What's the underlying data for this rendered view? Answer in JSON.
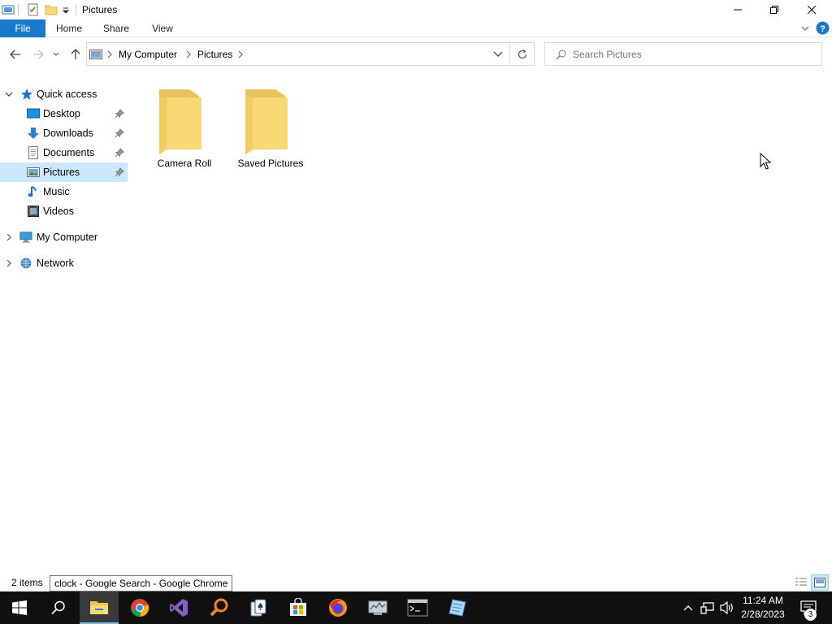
{
  "window": {
    "title": "Pictures",
    "minimize_icon": "minimize-icon",
    "restore_icon": "restore-icon",
    "close_icon": "close-icon"
  },
  "ribbon": {
    "tabs": [
      {
        "label": "File"
      },
      {
        "label": "Home"
      },
      {
        "label": "Share"
      },
      {
        "label": "View"
      }
    ],
    "accent": "#1979ca"
  },
  "address": {
    "crumbs": [
      "My Computer",
      "Pictures"
    ]
  },
  "search": {
    "placeholder": "Search Pictures"
  },
  "nav": {
    "quick_access": "Quick access",
    "items": [
      {
        "label": "Desktop",
        "pinned": true
      },
      {
        "label": "Downloads",
        "pinned": true
      },
      {
        "label": "Documents",
        "pinned": true
      },
      {
        "label": "Pictures",
        "pinned": true,
        "selected": true
      },
      {
        "label": "Music",
        "pinned": false
      },
      {
        "label": "Videos",
        "pinned": false
      }
    ],
    "my_computer": "My Computer",
    "network": "Network",
    "selected_color": "#cce8ff"
  },
  "content": {
    "folders": [
      {
        "name": "Camera Roll"
      },
      {
        "name": "Saved Pictures"
      }
    ]
  },
  "status": {
    "item_count": "2 items",
    "tooltip": "clock - Google Search - Google Chrome"
  },
  "taskbar": {
    "apps": [
      "start-icon",
      "search-icon",
      "file-explorer-icon",
      "chrome-icon",
      "visual-studio-icon",
      "magnifier-icon",
      "solitaire-icon",
      "store-icon",
      "firefox-icon",
      "network-monitor-icon",
      "terminal-icon",
      "notepad-icon"
    ],
    "time": "11:24 AM",
    "date": "2/28/2023",
    "notification_count": "3"
  }
}
